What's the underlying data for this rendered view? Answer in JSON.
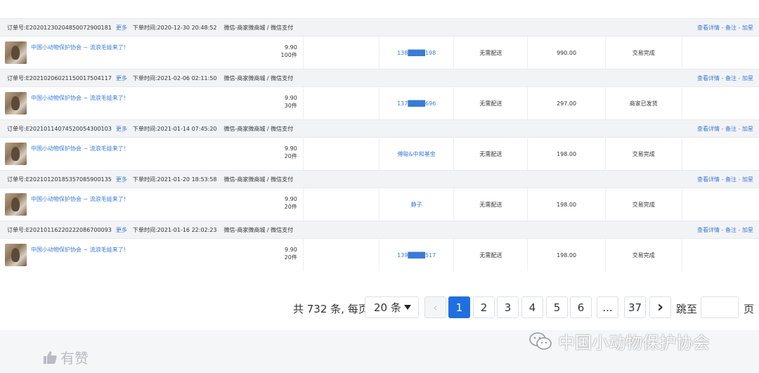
{
  "labels": {
    "order_no": "订单号:",
    "more": "更多",
    "order_time": "下单时间:",
    "actions": "查看详情 - 备注 - 加星"
  },
  "orders": [
    {
      "order_no": "E20201230204850072900181",
      "time": "2020-12-30 20:48:52",
      "channel": "微信-商家微商城 / 微信支付",
      "goods_title": "中国小动物保护协会 ~ 流浪毛娃来了!",
      "price": "9.90",
      "qty": "100件",
      "buyer": "138████198",
      "delivery": "无需配送",
      "amount": "990.00",
      "status": "交易完成"
    },
    {
      "order_no": "E20210206021150017504117",
      "time": "2021-02-06 02:11:50",
      "channel": "微信-商家微商城 / 微信支付",
      "goods_title": "中国小动物保护协会 ~ 流浪毛娃来了!",
      "price": "9.90",
      "qty": "30件",
      "buyer": "137████696",
      "delivery": "无需配送",
      "amount": "297.00",
      "status": "商家已发货"
    },
    {
      "order_no": "E20210114074520054300103",
      "time": "2021-01-14 07:45:20",
      "channel": "微信-商家微商城 / 微信支付",
      "goods_title": "中国小动物保护协会 ~ 流浪毛娃来了!",
      "price": "9.90",
      "qty": "20件",
      "buyer": "傅聪&中和基金",
      "delivery": "无需配送",
      "amount": "198.00",
      "status": "交易完成"
    },
    {
      "order_no": "E20210120185357085900135",
      "time": "2021-01-20 18:53:58",
      "channel": "微信-商家微商城 / 微信支付",
      "goods_title": "中国小动物保护协会 ~ 流浪毛娃来了!",
      "price": "9.90",
      "qty": "20件",
      "buyer": "静子",
      "delivery": "无需配送",
      "amount": "198.00",
      "status": "交易完成"
    },
    {
      "order_no": "E20210116220222086700093",
      "time": "2021-01-16 22:02:23",
      "channel": "微信-商家微商城 / 微信支付",
      "goods_title": "中国小动物保护协会 ~ 流浪毛娃来了!",
      "price": "9.90",
      "qty": "20件",
      "buyer": "139████517",
      "delivery": "无需配送",
      "amount": "198.00",
      "status": "交易完成"
    }
  ],
  "pagination": {
    "total_text": "共 732 条, 每页",
    "page_size": "20 条",
    "prev": "‹",
    "pages": [
      "1",
      "2",
      "3",
      "4",
      "5",
      "6"
    ],
    "ellipsis": "...",
    "last_page": "37",
    "next": "›",
    "jump_label": "跳至",
    "page_unit": "页",
    "current_page": "1"
  },
  "watermark": {
    "text": "中国小动物保护协会",
    "icon": "wechat-icon"
  },
  "footer": {
    "brand": "有赞",
    "icon": "thumbs-up-icon"
  },
  "colors": {
    "link": "#3a7bd5",
    "active_page": "#1f6fe0",
    "header_bg": "#f2f3f5"
  }
}
